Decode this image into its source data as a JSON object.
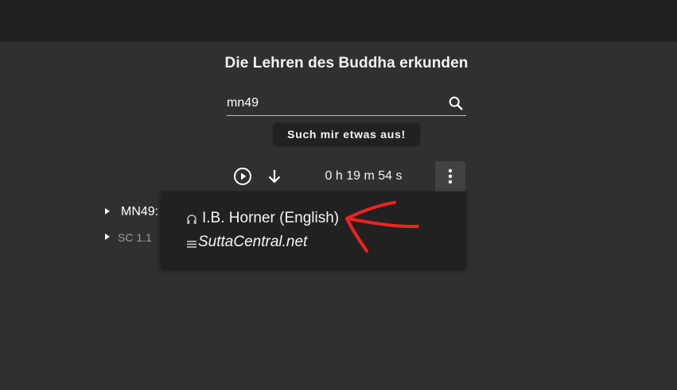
{
  "header": {
    "title": "Die Lehren des Buddha erkunden"
  },
  "search": {
    "value": "mn49",
    "icon": "search-icon"
  },
  "random_button": {
    "label": "Such mir etwas aus!"
  },
  "player": {
    "play_icon": "play-circle-icon",
    "download_icon": "arrow-down-icon",
    "duration": "0 h 19 m 54 s",
    "more_icon": "more-vertical-icon"
  },
  "tree": {
    "items": [
      {
        "label": "MN49:"
      },
      {
        "label": "SC 1.1"
      }
    ]
  },
  "menu": {
    "items": [
      {
        "icon": "headphones-icon",
        "label": "I.B. Horner (English)"
      },
      {
        "icon": "lines-icon",
        "label": "SuttaCentral.net"
      }
    ]
  },
  "annotation": {
    "color": "#ee2222"
  },
  "colors": {
    "background": "#303030",
    "topbar": "#212121",
    "menu": "#212121",
    "more_button": "#424242"
  }
}
